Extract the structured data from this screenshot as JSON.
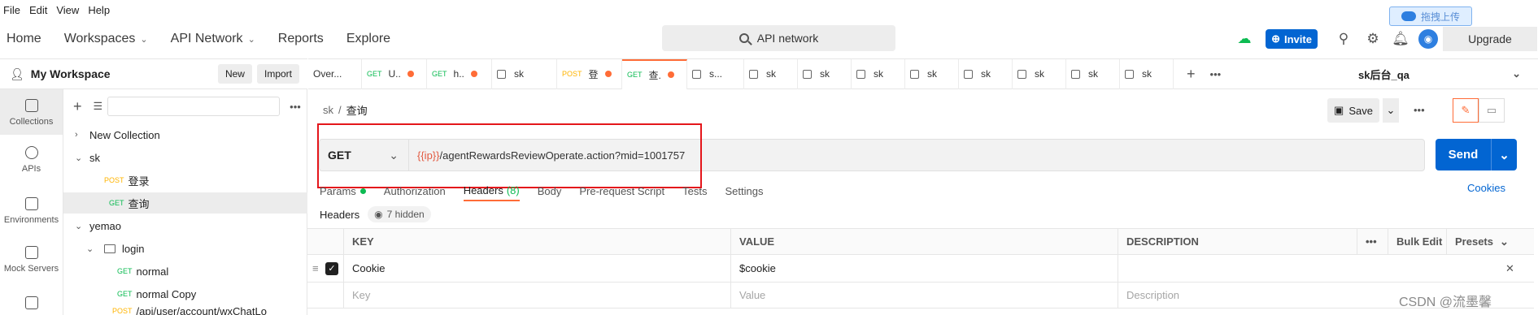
{
  "menubar": {
    "file": "File",
    "edit": "Edit",
    "view": "View",
    "help": "Help"
  },
  "upload_badge": "拖拽上传",
  "nav": {
    "home": "Home",
    "workspaces": "Workspaces",
    "api_network": "API Network",
    "reports": "Reports",
    "explore": "Explore"
  },
  "search": {
    "placeholder": "API network"
  },
  "invite_label": "Invite",
  "upgrade_label": "Upgrade",
  "workspace": {
    "title": "My Workspace",
    "new_label": "New",
    "import_label": "Import"
  },
  "rail": [
    {
      "label": "Collections"
    },
    {
      "label": "APIs"
    },
    {
      "label": "Environments"
    },
    {
      "label": "Mock Servers"
    }
  ],
  "tree": {
    "new_collection": "New Collection",
    "sk": "sk",
    "sk_login_method": "POST",
    "sk_login": "登录",
    "sk_query_method": "GET",
    "sk_query": "查询",
    "yemao": "yemao",
    "login_folder": "login",
    "normal_method": "GET",
    "normal": "normal",
    "normal_copy_method": "GET",
    "normal_copy": "normal Copy",
    "last_method": "POST",
    "last": "/api/user/account/wxChatLo"
  },
  "tabs": [
    {
      "method": "",
      "label": "Over...",
      "dot": false
    },
    {
      "method": "GET",
      "label": "U..",
      "dot": true
    },
    {
      "method": "GET",
      "label": "h..",
      "dot": true
    },
    {
      "method": "",
      "label": "sk",
      "dot": false
    },
    {
      "method": "POST",
      "label": "登",
      "dot": true
    },
    {
      "method": "GET",
      "label": "查.",
      "dot": true,
      "active": true
    },
    {
      "method": "",
      "label": "s...",
      "dot": false
    },
    {
      "method": "",
      "label": "sk",
      "dot": false
    },
    {
      "method": "",
      "label": "sk",
      "dot": false
    },
    {
      "method": "",
      "label": "sk",
      "dot": false
    },
    {
      "method": "",
      "label": "sk",
      "dot": false
    },
    {
      "method": "",
      "label": "sk",
      "dot": false
    },
    {
      "method": "",
      "label": "sk",
      "dot": false
    },
    {
      "method": "",
      "label": "sk",
      "dot": false
    },
    {
      "method": "",
      "label": "sk",
      "dot": false
    }
  ],
  "environment": "sk后台_qa",
  "breadcrumb": {
    "collection": "sk",
    "sep": "/",
    "request": "查询"
  },
  "save_label": "Save",
  "request": {
    "method": "GET",
    "url_var": "{{ip}}",
    "url_path": "/agentRewardsReviewOperate.action?mid=1001757"
  },
  "send_label": "Send",
  "req_tabs": {
    "params": "Params",
    "authorization": "Authorization",
    "headers": "Headers",
    "headers_count": "(8)",
    "body": "Body",
    "prerequest": "Pre-request Script",
    "tests": "Tests",
    "settings": "Settings"
  },
  "cookies_label": "Cookies",
  "headers_sub": {
    "title": "Headers",
    "hidden": "7 hidden"
  },
  "table": {
    "col_key": "KEY",
    "col_value": "VALUE",
    "col_description": "DESCRIPTION",
    "more": "•••",
    "bulk_edit": "Bulk Edit",
    "presets": "Presets",
    "row_key": "Cookie",
    "row_value": "$cookie",
    "ph_key": "Key",
    "ph_value": "Value",
    "ph_description": "Description"
  },
  "watermark": "CSDN @流墨馨",
  "colors": {
    "accent": "#ff6c37",
    "primary": "#0265d2",
    "get": "#0cbb52",
    "post": "#ffb400",
    "highlight": "#e4161b"
  }
}
